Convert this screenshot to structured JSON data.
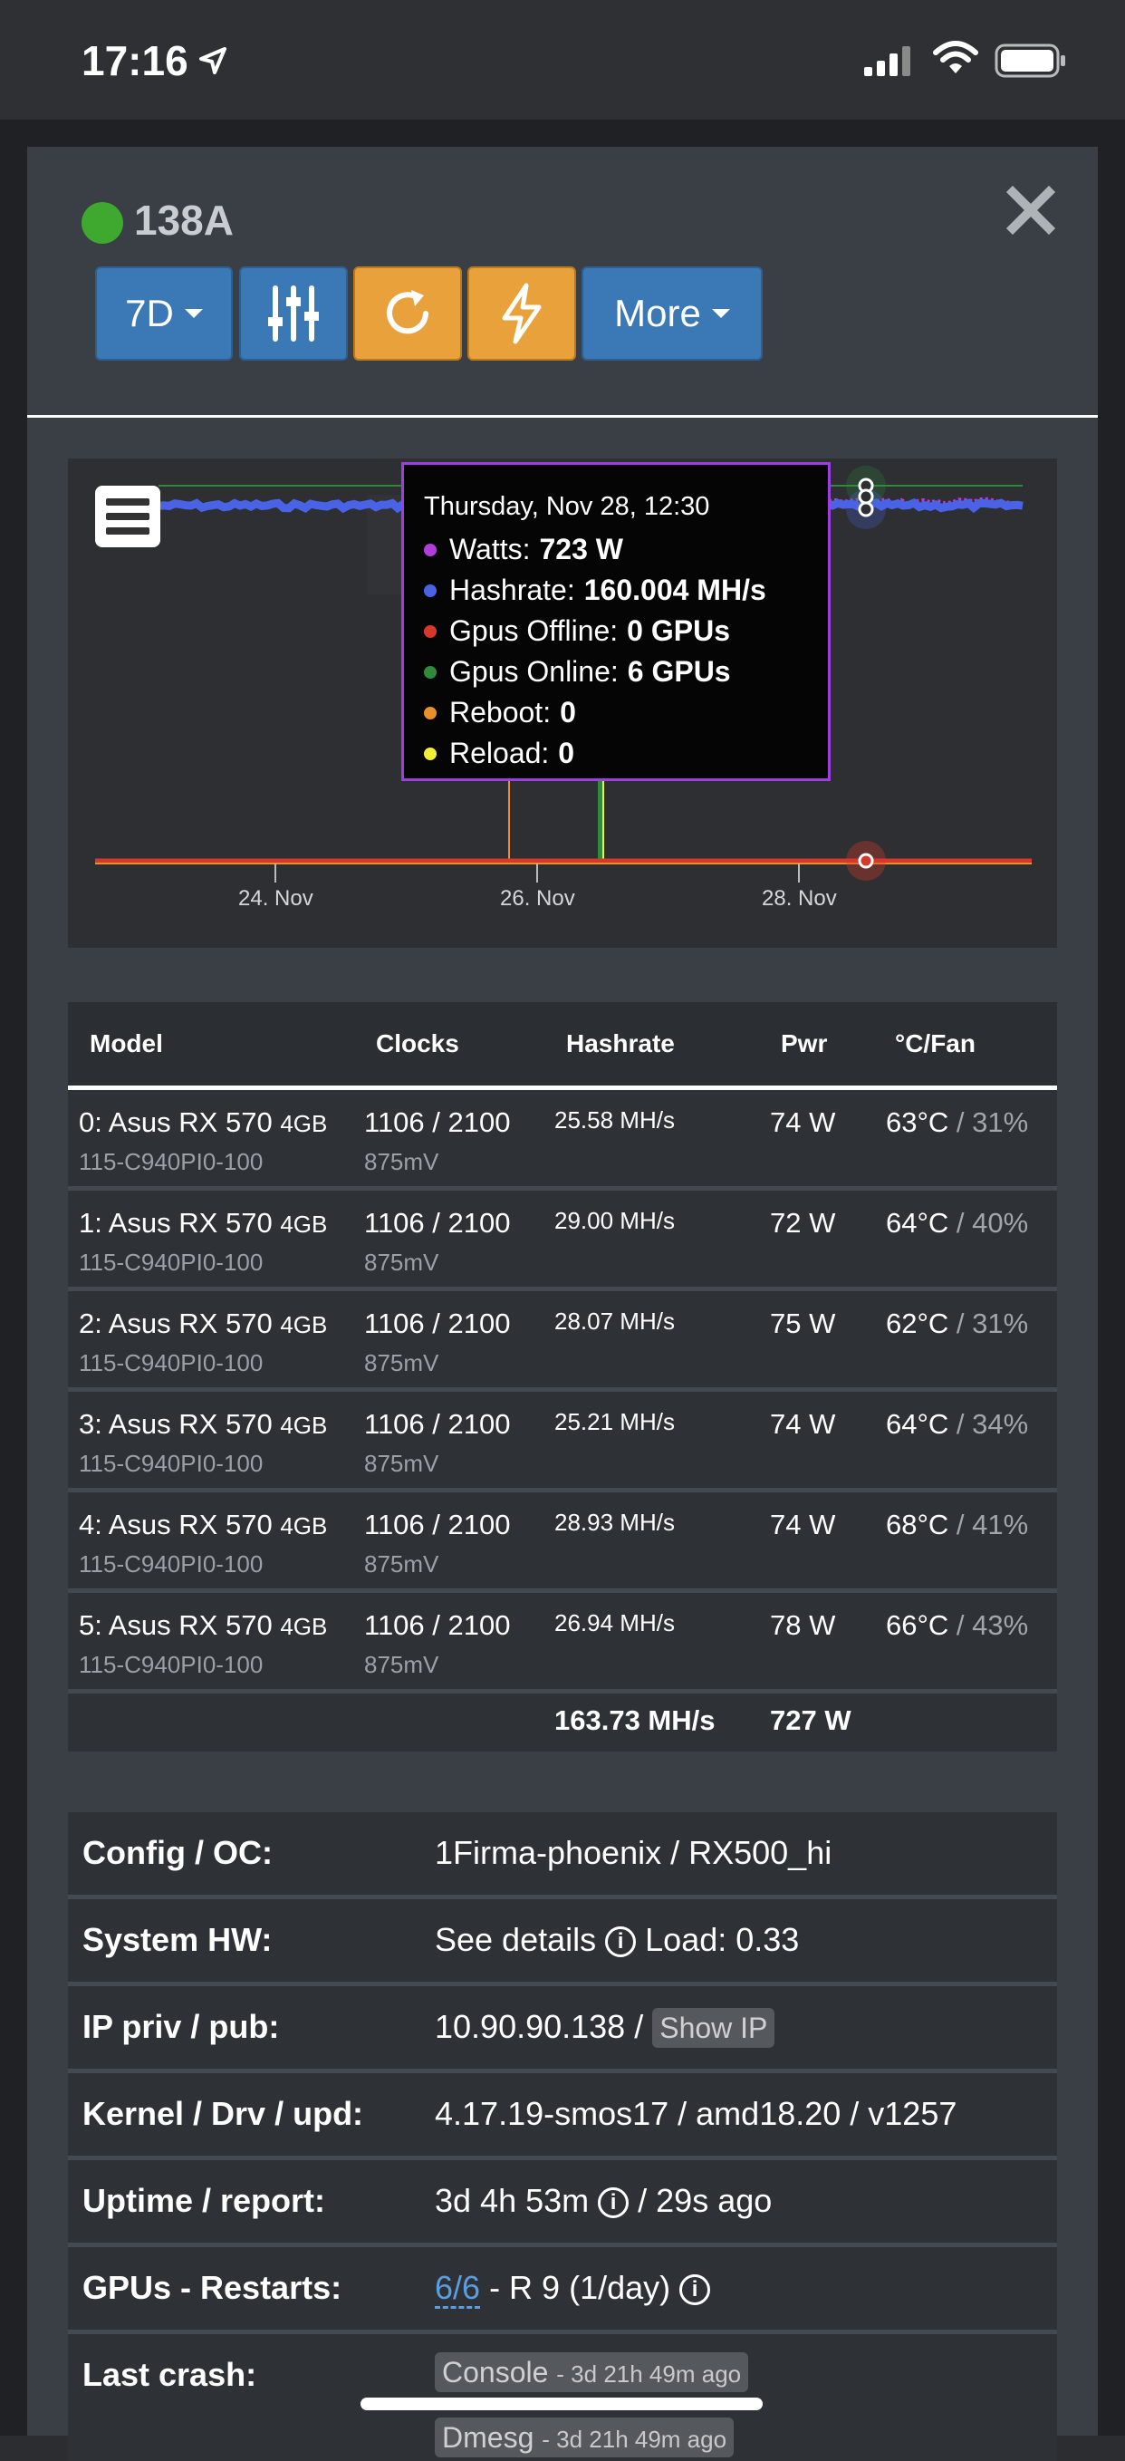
{
  "status": {
    "time": "17:16"
  },
  "rig": {
    "name": "138A",
    "status_color": "#3fa82e"
  },
  "toolbar": {
    "period_label": "7D",
    "more_label": "More"
  },
  "chart_data": {
    "type": "line",
    "x_ticks": [
      "24. Nov",
      "26. Nov",
      "28. Nov"
    ],
    "series": [
      {
        "name": "Watts",
        "color": "#b23ddb",
        "unit": "W",
        "approx_value": 723
      },
      {
        "name": "Hashrate",
        "color": "#4a63e6",
        "unit": "MH/s",
        "approx_value": 160.004
      },
      {
        "name": "Gpus Offline",
        "color": "#d6392c",
        "unit": "GPUs",
        "approx_value": 0
      },
      {
        "name": "Gpus Online",
        "color": "#2f8a3a",
        "unit": "GPUs",
        "approx_value": 6
      },
      {
        "name": "Reboot",
        "color": "#e9902b",
        "approx_value": 0
      },
      {
        "name": "Reload",
        "color": "#f3ef35",
        "approx_value": 0
      }
    ],
    "tooltip": {
      "title": "Thursday, Nov 28, 12:30",
      "rows": [
        {
          "label": "Watts:",
          "value": "723 W",
          "color": "#b23ddb"
        },
        {
          "label": "Hashrate:",
          "value": "160.004 MH/s",
          "color": "#4a63e6"
        },
        {
          "label": "Gpus Offline:",
          "value": "0 GPUs",
          "color": "#d6392c"
        },
        {
          "label": "Gpus Online:",
          "value": "6 GPUs",
          "color": "#2f8a3a"
        },
        {
          "label": "Reboot:",
          "value": "0",
          "color": "#e9902b"
        },
        {
          "label": "Reload:",
          "value": "0",
          "color": "#f3ef35"
        }
      ]
    }
  },
  "gpu_table": {
    "headers": [
      "Model",
      "Clocks",
      "Hashrate",
      "Pwr",
      "°C/Fan"
    ],
    "rows": [
      {
        "model": "0: Asus RX 570",
        "mem": "4GB",
        "bios": "115-C940PI0-100",
        "clocks": "1106 / 2100",
        "volt": "875mV",
        "hashrate": "25.58 MH/s",
        "pwr": "74 W",
        "temp": "63°C",
        "fan": "/ 31%"
      },
      {
        "model": "1: Asus RX 570",
        "mem": "4GB",
        "bios": "115-C940PI0-100",
        "clocks": "1106 / 2100",
        "volt": "875mV",
        "hashrate": "29.00 MH/s",
        "pwr": "72 W",
        "temp": "64°C",
        "fan": "/ 40%"
      },
      {
        "model": "2: Asus RX 570",
        "mem": "4GB",
        "bios": "115-C940PI0-100",
        "clocks": "1106 / 2100",
        "volt": "875mV",
        "hashrate": "28.07 MH/s",
        "pwr": "75 W",
        "temp": "62°C",
        "fan": "/ 31%"
      },
      {
        "model": "3: Asus RX 570",
        "mem": "4GB",
        "bios": "115-C940PI0-100",
        "clocks": "1106 / 2100",
        "volt": "875mV",
        "hashrate": "25.21 MH/s",
        "pwr": "74 W",
        "temp": "64°C",
        "fan": "/ 34%"
      },
      {
        "model": "4: Asus RX 570",
        "mem": "4GB",
        "bios": "115-C940PI0-100",
        "clocks": "1106 / 2100",
        "volt": "875mV",
        "hashrate": "28.93 MH/s",
        "pwr": "74 W",
        "temp": "68°C",
        "fan": "/ 41%"
      },
      {
        "model": "5: Asus RX 570",
        "mem": "4GB",
        "bios": "115-C940PI0-100",
        "clocks": "1106 / 2100",
        "volt": "875mV",
        "hashrate": "26.94 MH/s",
        "pwr": "78 W",
        "temp": "66°C",
        "fan": "/ 43%"
      }
    ],
    "total_hashrate": "163.73 MH/s",
    "total_power": "727 W"
  },
  "info": {
    "config_label": "Config / OC:",
    "config_value": "1Firma-phoenix / RX500_hi",
    "hw_label": "System HW:",
    "hw_details": "See details",
    "hw_load": "Load: 0.33",
    "ip_label": "IP priv / pub:",
    "ip_value": "10.90.90.138 /",
    "show_ip": "Show IP",
    "kernel_label": "Kernel / Drv / upd:",
    "kernel_value": "4.17.19-smos17 / amd18.20 / v1257",
    "uptime_label": "Uptime / report:",
    "uptime_value": "3d 4h 53m",
    "report_value": "/ 29s ago",
    "gpus_label": "GPUs - Restarts:",
    "gpus_link": "6/6",
    "restarts_value": "- R 9 (1/day)",
    "crash_label": "Last crash:",
    "console_label": "Console",
    "console_time": "- 3d 21h 49m ago",
    "dmesg_label": "Dmesg",
    "dmesg_time": "- 3d 21h 49m ago"
  }
}
